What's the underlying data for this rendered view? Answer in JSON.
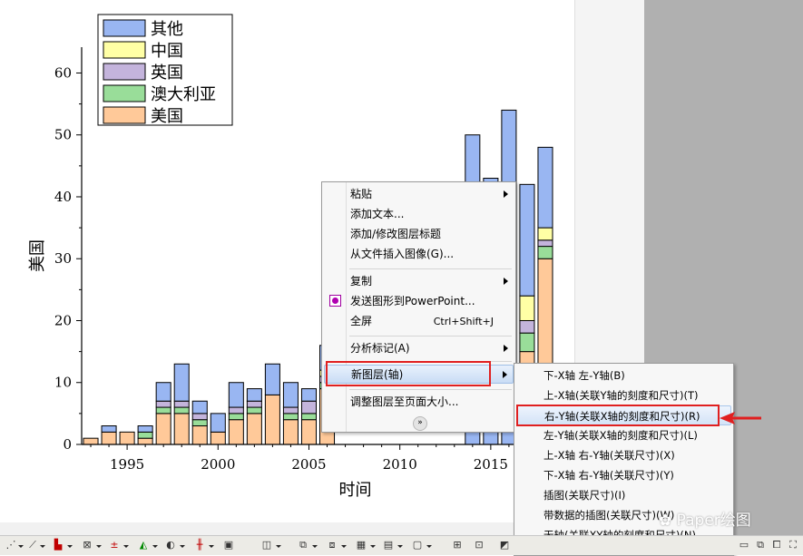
{
  "chart_data": {
    "type": "bar",
    "stacked": true,
    "xlabel": "时间",
    "ylabel": "美国",
    "x": [
      1993,
      1994,
      1995,
      1996,
      1997,
      1998,
      1999,
      2000,
      2001,
      2002,
      2003,
      2004,
      2005,
      2006,
      2007,
      2008,
      2009,
      2010,
      2011,
      2012,
      2013,
      2014,
      2015,
      2016,
      2017,
      2018
    ],
    "x_ticks": [
      1995,
      2000,
      2005,
      2010,
      2015
    ],
    "y_ticks": [
      0,
      10,
      20,
      30,
      40,
      50,
      60
    ],
    "xlim": [
      1992.5,
      2018.6
    ],
    "ylim": [
      0,
      63
    ],
    "legend_position": "top-left",
    "series": [
      {
        "name": "美国",
        "color": "#FFC999",
        "values": [
          1,
          2,
          2,
          1,
          5,
          5,
          3,
          2,
          4,
          5,
          8,
          4,
          4,
          9,
          0,
          0,
          0,
          0,
          0,
          0,
          0,
          0,
          0,
          0,
          15,
          30
        ]
      },
      {
        "name": "澳大利亚",
        "color": "#99DD99",
        "values": [
          0,
          0,
          0,
          1,
          1,
          1,
          1,
          0,
          1,
          1,
          0,
          1,
          1,
          1,
          0,
          0,
          0,
          0,
          0,
          0,
          0,
          0,
          0,
          0,
          3,
          2
        ]
      },
      {
        "name": "英国",
        "color": "#C4B4DC",
        "values": [
          0,
          0,
          0,
          0,
          1,
          1,
          1,
          0,
          1,
          1,
          0,
          1,
          2,
          1,
          0,
          0,
          0,
          0,
          0,
          0,
          0,
          0,
          0,
          0,
          2,
          1
        ]
      },
      {
        "name": "中国",
        "color": "#FFFFA5",
        "values": [
          0,
          0,
          0,
          0,
          0,
          0,
          0,
          0,
          0,
          0,
          0,
          0,
          0,
          1,
          0,
          0,
          0,
          0,
          0,
          0,
          0,
          0,
          0,
          0,
          4,
          2
        ]
      },
      {
        "name": "其他",
        "color": "#99B6F2",
        "values": [
          0,
          1,
          0,
          1,
          3,
          6,
          2,
          3,
          4,
          2,
          5,
          4,
          2,
          4,
          0,
          0,
          0,
          0,
          0,
          0,
          0,
          50,
          43,
          54,
          18,
          13
        ]
      }
    ]
  },
  "context_menu": {
    "items": [
      {
        "label": "粘贴",
        "submenu": true
      },
      {
        "label": "添加文本..."
      },
      {
        "label": "添加/修改图层标题"
      },
      {
        "label": "从文件插入图像(G)..."
      },
      {
        "label": "复制",
        "submenu": true
      },
      {
        "label": "发送图形到PowerPoint...",
        "icon": "powerpoint-icon"
      },
      {
        "label": "全屏",
        "shortcut": "Ctrl+Shift+J"
      },
      {
        "label": "分析标记(A)",
        "submenu": true
      },
      {
        "label": "新图层(轴)",
        "submenu": true
      },
      {
        "label": "调整图层至页面大小..."
      }
    ],
    "expand_glyph": "»"
  },
  "submenu": {
    "items": [
      {
        "label": "下-X轴 左-Y轴(B)"
      },
      {
        "label": "上-X轴(关联Y轴的刻度和尺寸)(T)"
      },
      {
        "label": "右-Y轴(关联X轴的刻度和尺寸)(R)"
      },
      {
        "label": "左-Y轴(关联X轴的刻度和尺寸)(L)"
      },
      {
        "label": "上-X轴 右-Y轴(关联尺寸)(X)"
      },
      {
        "label": "下-X轴 右-Y轴(关联尺寸)(Y)"
      },
      {
        "label": "插图(关联尺寸)(I)"
      },
      {
        "label": "带数据的插图(关联尺寸)(W)"
      },
      {
        "label": "无轴(关联XY轴的刻度和尺寸)(N)"
      }
    ]
  },
  "colors": {
    "highlight_box": "#E02020"
  },
  "watermark": "Paper绘图"
}
